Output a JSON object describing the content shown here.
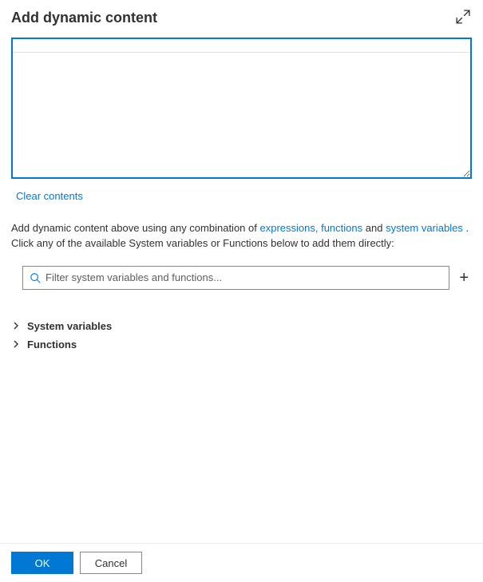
{
  "header": {
    "title": "Add dynamic content"
  },
  "editor": {
    "value": "",
    "clear_label": "Clear contents"
  },
  "help": {
    "prefix": "Add dynamic content above using any combination of ",
    "link_expressions": "expressions,",
    "link_functions": "functions",
    "mid": " and ",
    "link_system_variables": "system variables",
    "suffix": " . Click any of the available System variables or Functions below to add them directly:"
  },
  "filter": {
    "placeholder": "Filter system variables and functions..."
  },
  "tree": {
    "items": [
      {
        "label": "System variables"
      },
      {
        "label": "Functions"
      }
    ]
  },
  "footer": {
    "ok": "OK",
    "cancel": "Cancel"
  }
}
